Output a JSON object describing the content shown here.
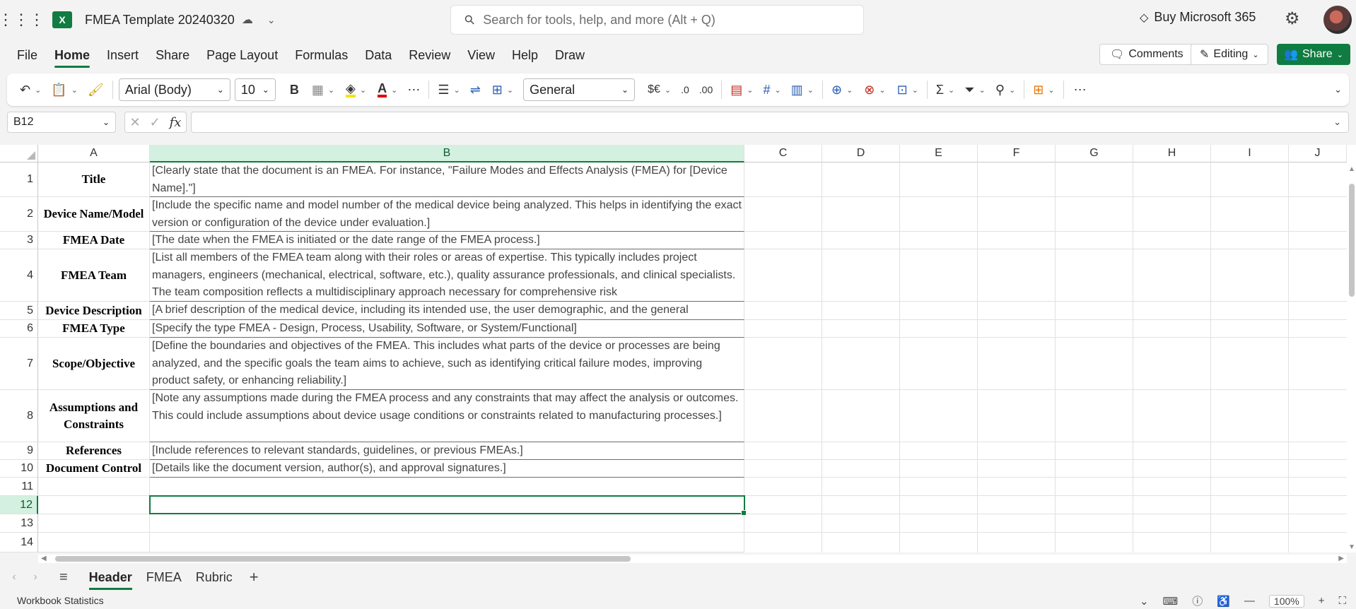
{
  "app": {
    "title": "FMEA Template 20240320",
    "search_placeholder": "Search for tools, help, and more (Alt + Q)",
    "buy_label": "Buy Microsoft 365",
    "logo_letter": "X"
  },
  "menu": {
    "tabs": [
      "File",
      "Home",
      "Insert",
      "Share",
      "Page Layout",
      "Formulas",
      "Data",
      "Review",
      "View",
      "Help",
      "Draw"
    ],
    "active": "Home",
    "comments_label": "Comments",
    "editing_label": "Editing",
    "share_label": "Share"
  },
  "ribbon": {
    "font_name": "Arial (Body)",
    "font_size": "10",
    "number_format": "General",
    "bold_label": "B",
    "currency_label": "$€"
  },
  "formula_bar": {
    "name_box": "B12",
    "fx_label": "fx",
    "formula": ""
  },
  "columns": [
    "A",
    "B",
    "C",
    "D",
    "E",
    "F",
    "G",
    "H",
    "I",
    "J"
  ],
  "selected_column": "B",
  "selected_row": "12",
  "rows": [
    {
      "num": "1",
      "label": "Title",
      "text": "[Clearly state that the document is an FMEA. For instance, \"Failure Modes and Effects Analysis (FMEA) for [Device Name].\"]"
    },
    {
      "num": "2",
      "label": "Device Name/Model",
      "text": "[Include the specific name and model number of the medical device being analyzed. This helps in identifying the exact version or configuration of the device under evaluation.]"
    },
    {
      "num": "3",
      "label": "FMEA Date",
      "text": "[The date when the FMEA is initiated or the date range of the FMEA process.]"
    },
    {
      "num": "4",
      "label": "FMEA Team",
      "text": "[List all members of the FMEA team along with their roles or areas of expertise. This typically includes project managers, engineers (mechanical, electrical, software, etc.), quality assurance professionals, and clinical specialists. The team composition reflects a multidisciplinary approach necessary for comprehensive risk"
    },
    {
      "num": "5",
      "label": "Device Description",
      "text": "[A brief description of the medical device, including its intended use, the user demographic, and the general"
    },
    {
      "num": "6",
      "label": "FMEA Type",
      "text": "[Specify the type FMEA - Design, Process, Usability, Software, or System/Functional]"
    },
    {
      "num": "7",
      "label": "Scope/Objective",
      "text": "[Define the boundaries and objectives of the FMEA. This includes what parts of the device or processes are being analyzed, and the specific goals the team aims to achieve, such as identifying critical failure modes, improving product safety, or enhancing reliability.]"
    },
    {
      "num": "8",
      "label": "Assumptions and Constraints",
      "text": "[Note any assumptions made during the FMEA process and any constraints that may affect the analysis or outcomes. This could include assumptions about device usage conditions or constraints related to manufacturing processes.]"
    },
    {
      "num": "9",
      "label": "References",
      "text": "[Include references to relevant standards, guidelines, or previous FMEAs.]"
    },
    {
      "num": "10",
      "label": "Document Control",
      "text": "[Details like the document version, author(s), and approval signatures.]"
    },
    {
      "num": "11",
      "label": "",
      "text": ""
    },
    {
      "num": "12",
      "label": "",
      "text": ""
    },
    {
      "num": "13",
      "label": "",
      "text": ""
    },
    {
      "num": "14",
      "label": "",
      "text": ""
    }
  ],
  "sheets": [
    "Header",
    "FMEA",
    "Rubric"
  ],
  "active_sheet": "Header",
  "status": {
    "workbook_stats": "Workbook Statistics",
    "zoom": "100%"
  },
  "colors": {
    "accent": "#107c41",
    "selection_header": "#d3f0e0"
  }
}
